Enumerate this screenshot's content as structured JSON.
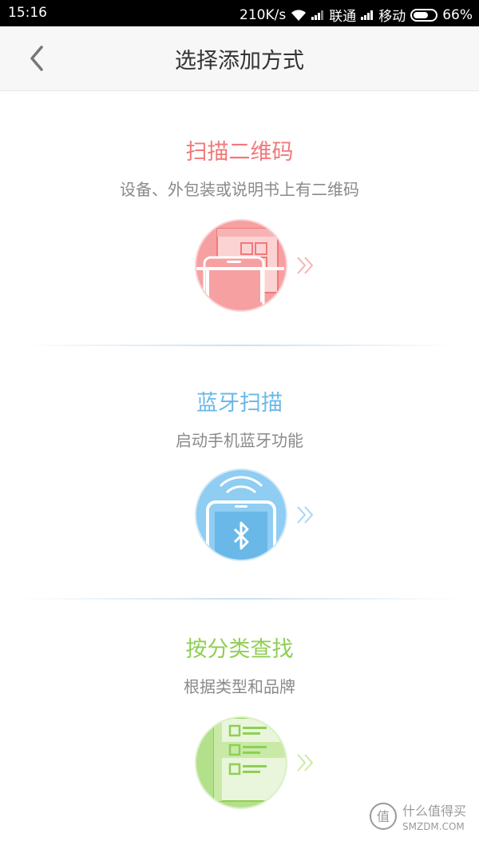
{
  "status": {
    "time": "15:16",
    "speed": "210K/s",
    "carrier1": "联通",
    "carrier2": "移动",
    "battery": "66%"
  },
  "nav": {
    "title": "选择添加方式"
  },
  "options": [
    {
      "title": "扫描二维码",
      "subtitle": "设备、外包装或说明书上有二维码",
      "color": "#f2787a",
      "icon": "qr-scan-icon"
    },
    {
      "title": "蓝牙扫描",
      "subtitle": "启动手机蓝牙功能",
      "color": "#6ab8e8",
      "icon": "bluetooth-icon"
    },
    {
      "title": "按分类查找",
      "subtitle": "根据类型和品牌",
      "color": "#8fcf54",
      "icon": "category-list-icon"
    }
  ],
  "watermark": {
    "line1": "什么值得买",
    "line2": "SMZDM.COM"
  }
}
